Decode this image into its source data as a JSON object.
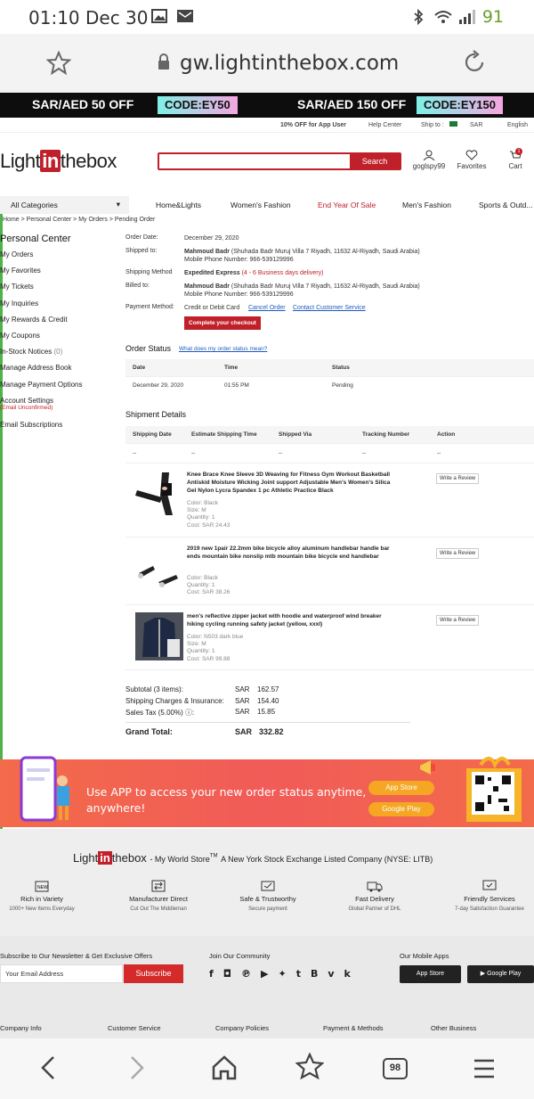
{
  "status_bar": {
    "time": "01:10 Dec 30",
    "battery": "91"
  },
  "browser": {
    "url": "gw.lightinthebox.com",
    "tabs_count": "98"
  },
  "promo": {
    "left_text": "SAR/AED 50 OFF",
    "left_code": "CODE:EY50",
    "right_text": "SAR/AED 150 OFF",
    "right_code": "CODE:EY150"
  },
  "util": {
    "app_offer": "10% OFF for App User",
    "help": "Help Center",
    "ship_to": "Ship to :",
    "currency": "SAR",
    "lang": "English"
  },
  "header": {
    "logo_pre": "Light",
    "logo_in": "in",
    "logo_post": "thebox",
    "search_button": "Search",
    "account": "goglspy99",
    "favorites": "Favorites",
    "cart": "Cart",
    "cart_count": "1"
  },
  "nav": {
    "all_categories": "All Categories",
    "items": [
      "Home&Lights",
      "Women's Fashion",
      "End Year Of Sale",
      "Men's Fashion",
      "Sports & Outd..."
    ]
  },
  "breadcrumb": "Home > Personal Center > My Orders > Pending Order",
  "sidebar": {
    "title": "Personal Center",
    "links": [
      "My Orders",
      "My Favorites",
      "My Tickets",
      "My Inquiries",
      "My Rewards & Credit",
      "My Coupons",
      "In-Stock Notices",
      "Manage Address Book",
      "Manage Payment Options",
      "Account Settings",
      "Email Subscriptions"
    ],
    "instock_count": "(0)",
    "email_unconfirmed": "(Email Unconfirmed)"
  },
  "order": {
    "order_date_label": "Order Date:",
    "order_date": "December 29, 2020",
    "shipped_to_label": "Shipped to:",
    "name": "Mahmoud Badr",
    "address": "(Shuhada Badr Muruj Villa 7 Riyadh, 11632 Al-Riyadh, Saudi Arabia)",
    "phone": "Mobile Phone Number: 966-539129996",
    "ship_method_label": "Shipping Method",
    "ship_method": "Expedited Express",
    "ship_days": "(4 - 6 Business days delivery)",
    "billed_to_label": "Billed to:",
    "payment_label": "Payment Method:",
    "payment": "Credit or Debit Card",
    "cancel": "Cancel Order",
    "contact": "Contact Customer Service",
    "complete_button": "Complete your checkout"
  },
  "status": {
    "heading": "Order Status",
    "help_link": "What does my order status mean?",
    "headers": [
      "Date",
      "Time",
      "Status"
    ],
    "row": [
      "December 29, 2020",
      "01:55 PM",
      "Pending"
    ]
  },
  "shipment": {
    "heading": "Shipment Details",
    "headers": [
      "Shipping Date",
      "Estimate Shipping Time",
      "Shipped Via",
      "Tracking Number",
      "Action"
    ],
    "dash": "--"
  },
  "products": [
    {
      "title": "Knee Brace Knee Sleeve 3D Weaving for Fitness Gym Workout Basketball Antiskid Moisture Wicking Joint support Adjustable Men's Women's Silica Gel Nylon Lycra Spandex 1 pc Athletic Practice Black",
      "meta": [
        "Color: Black",
        "Size: M",
        "Quantity: 1",
        "Cost: SAR 24.43"
      ]
    },
    {
      "title": "2019 new 1pair 22.2mm bike bicycle alloy aluminum handlebar handle bar ends mountain bike nonslip mtb mountain bike bicycle end handlebar",
      "meta": [
        "Color: Black",
        "Quantity: 1",
        "Cost: SAR 38.26"
      ]
    },
    {
      "title": "men's reflective zipper jacket with hoodie and waterproof wind breaker hiking cycling running safety jacket (yellow, xxxl)",
      "meta": [
        "Color: N503 dark blue",
        "Size: M",
        "Quantity: 1",
        "Cost: SAR 99.88"
      ]
    }
  ],
  "review_button": "Write a Review",
  "totals": {
    "subtotal_label": "Subtotal (3 items):",
    "subtotal": "162.57",
    "shipping_label": "Shipping Charges & Insurance:",
    "shipping": "154.40",
    "tax_label": "Sales Tax (5.00%) ⓘ:",
    "tax": "15.85",
    "grand_label": "Grand Total:",
    "grand": "332.82",
    "currency": "SAR"
  },
  "app_banner": {
    "line1": "Use APP to access your new order status anytime,",
    "line2": "anywhere!",
    "app_store": "App Store",
    "google_play": "Google Play"
  },
  "footer": {
    "tagline": "- My World Store",
    "tm": "TM",
    "nyse": "A New York Stock Exchange Listed Company (NYSE: LITB)",
    "features": [
      {
        "title": "Rich in Variety",
        "sub": "1000+ New Items Everyday"
      },
      {
        "title": "Manufacturer Direct",
        "sub": "Cut Out The Middleman"
      },
      {
        "title": "Safe & Trustworthy",
        "sub": "Secure payment"
      },
      {
        "title": "Fast Delivery",
        "sub": "Global Partner of DHL"
      },
      {
        "title": "Friendly Services",
        "sub": "7-day Satisfaction Guarantee"
      }
    ],
    "newsletter": "Subscribe to Our Newsletter & Get Exclusive Offers",
    "email_placeholder": "Your Email Address",
    "subscribe": "Subscribe",
    "community": "Join Our Community",
    "mobile_apps": "Our Mobile Apps",
    "app_store": "App Store",
    "google_play": "Google Play",
    "cols": [
      "Company Info",
      "Customer Service",
      "Company Policies",
      "Payment & Methods",
      "Other Business"
    ]
  }
}
